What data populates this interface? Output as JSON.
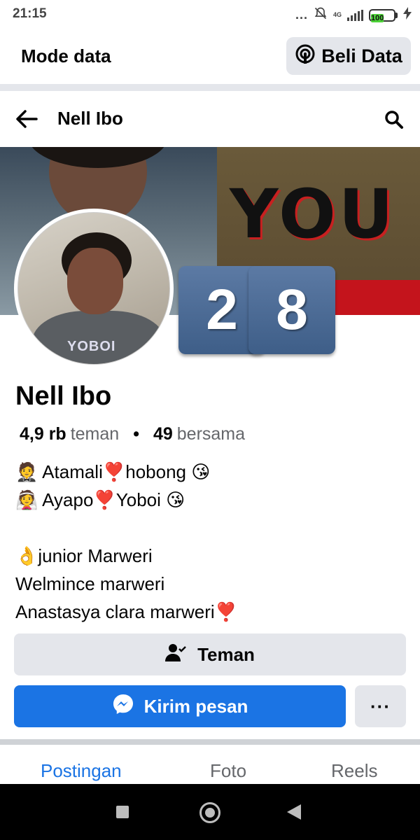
{
  "status_bar": {
    "time": "21:15",
    "dots": "...",
    "network": "4G",
    "battery": "100"
  },
  "data_bar": {
    "label": "Mode data",
    "buy_button": "Beli Data"
  },
  "header": {
    "title": "Nell Ibo"
  },
  "cover": {
    "text": "YOU",
    "tiles": [
      "2",
      "8"
    ]
  },
  "profile": {
    "name": "Nell Ibo",
    "friends_count": "4,9 rb",
    "friends_label": "teman",
    "separator": "•",
    "mutual_count": "49",
    "mutual_label": "bersama",
    "bio": [
      "🤵 Atamali❣️hobong 😘",
      "👰 Ayapo❣️Yoboi 😘",
      "",
      "👌junior Marweri",
      "Welmince marweri",
      "Anastasya clara marweri❣️"
    ]
  },
  "actions": {
    "friends_button": "Teman",
    "message_button": "Kirim pesan",
    "more_button": "···"
  },
  "tabs": [
    "Postingan",
    "Foto",
    "Reels"
  ],
  "colors": {
    "accent": "#1b74e4",
    "button_bg": "#e4e6eb",
    "secondary_text": "#65676b"
  }
}
